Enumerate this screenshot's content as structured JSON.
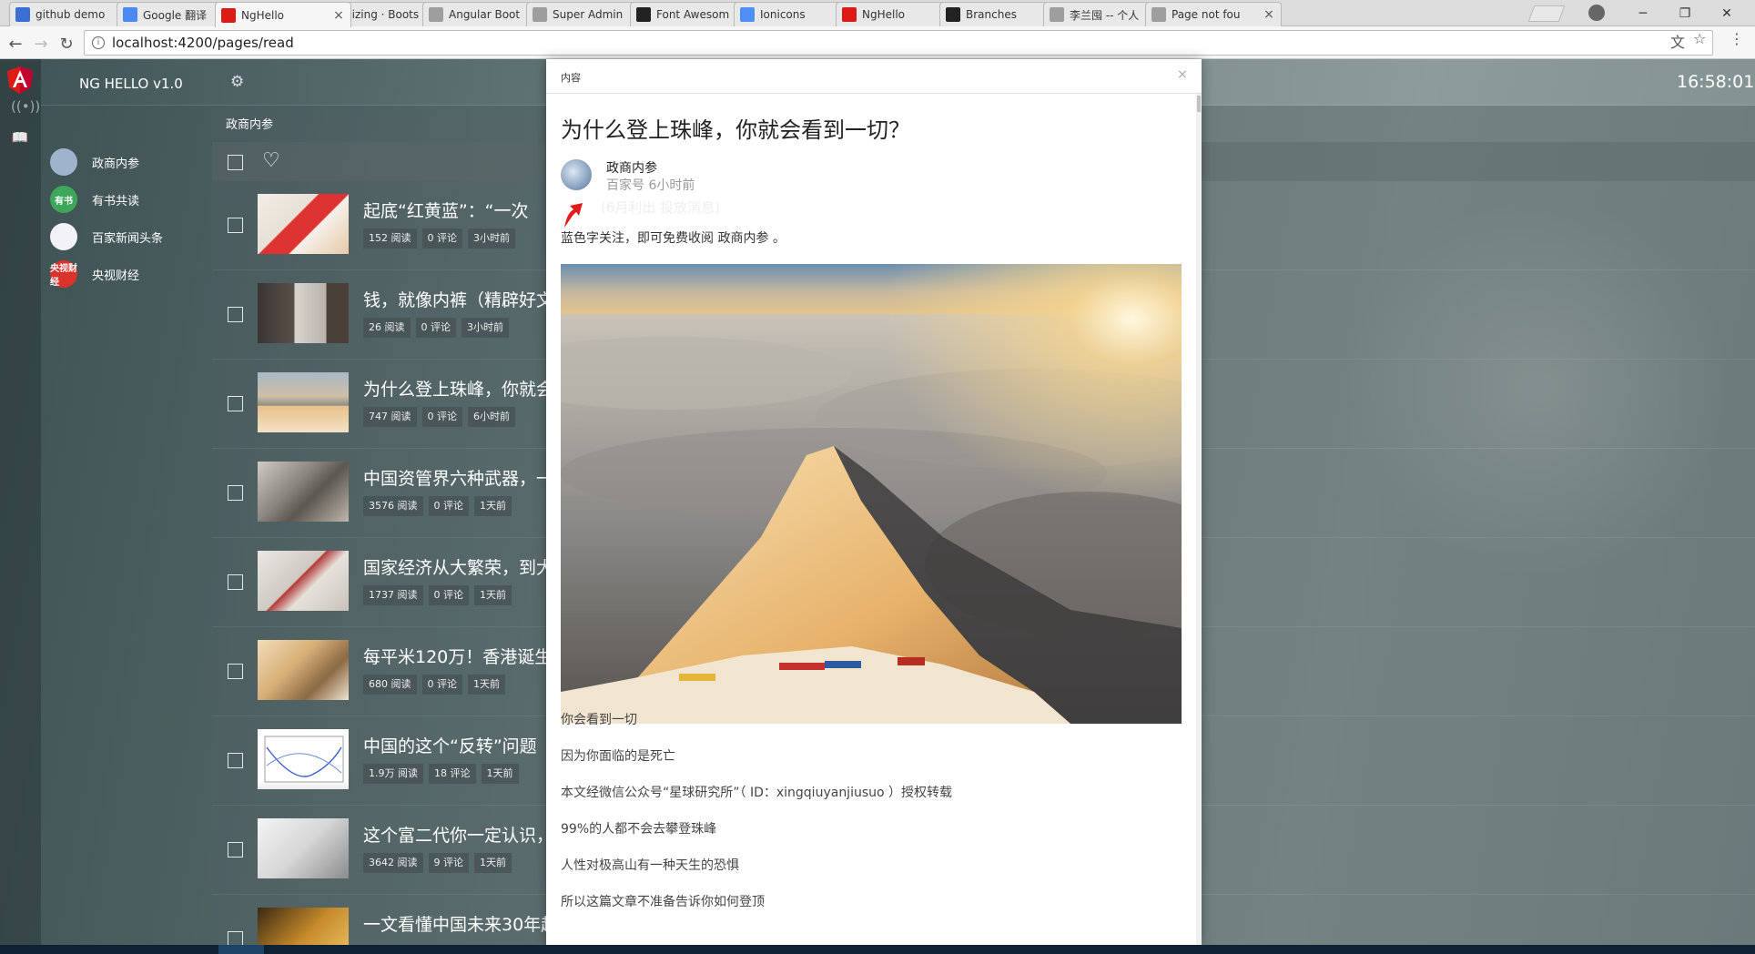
{
  "browser": {
    "tabs": [
      {
        "title": "github demo",
        "icon": "github-translate-icon",
        "color": "#3b6fd6"
      },
      {
        "title": "Google 翻译",
        "icon": "google-translate-icon",
        "color": "#4a8af4"
      },
      {
        "title": "NgHello",
        "icon": "angular-icon",
        "color": "#dd1b16",
        "active": true
      },
      {
        "title": "Sizing · Boots",
        "icon": "bootstrap-icon",
        "color": "#563d7c"
      },
      {
        "title": "Angular Boot",
        "icon": "page-icon",
        "color": "#9e9e9e"
      },
      {
        "title": "Super Admin",
        "icon": "page-icon",
        "color": "#9e9e9e"
      },
      {
        "title": "Font Awesom",
        "icon": "font-awesome-icon",
        "color": "#222222"
      },
      {
        "title": "Ionicons",
        "icon": "ionicons-icon",
        "color": "#4e8ef7"
      },
      {
        "title": "NgHello",
        "icon": "angular-icon",
        "color": "#dd1b16"
      },
      {
        "title": "Branches",
        "icon": "github-icon",
        "color": "#222222"
      },
      {
        "title": "李兰囤 -- 个人",
        "icon": "page-icon",
        "color": "#9e9e9e"
      },
      {
        "title": "Page not fou",
        "icon": "page-icon",
        "color": "#9e9e9e"
      }
    ],
    "url": "localhost:4200/pages/read"
  },
  "app": {
    "brand": "NG HELLO v1.0",
    "clock": "16:58:01",
    "sidebar": [
      {
        "label": "政商内参",
        "avatar_color": "#9fb4cc",
        "avatar_text": ""
      },
      {
        "label": "有书共读",
        "avatar_color": "#3da75b",
        "avatar_text": "有书"
      },
      {
        "label": "百家新闻头条",
        "avatar_color": "#f2f2f7",
        "avatar_text": ""
      },
      {
        "label": "央视财经",
        "avatar_color": "#d9332b",
        "avatar_text": "央视财经"
      }
    ],
    "column_title": "政商内参",
    "articles": [
      {
        "title": "起底“红黄蓝”：“一次",
        "reads": "152 阅读",
        "comments": "0 评论",
        "time": "3小时前",
        "thumb": "red-room"
      },
      {
        "title": "钱，就像内裤（精辟好文",
        "reads": "26 阅读",
        "comments": "0 评论",
        "time": "3小时前",
        "thumb": "window-man"
      },
      {
        "title": "为什么登上珠峰，你就会",
        "reads": "747 阅读",
        "comments": "0 评论",
        "time": "6小时前",
        "thumb": "mountain"
      },
      {
        "title": "中国资管界六种武器，一",
        "reads": "3576 阅读",
        "comments": "0 评论",
        "time": "1天前",
        "thumb": "machine"
      },
      {
        "title": "国家经济从大繁荣，到大",
        "reads": "1737 阅读",
        "comments": "0 评论",
        "time": "1天前",
        "thumb": "graffiti"
      },
      {
        "title": "每平米120万！香港诞生",
        "reads": "680 阅读",
        "comments": "0 评论",
        "time": "1天前",
        "thumb": "interior"
      },
      {
        "title": "中国的这个“反转”问题",
        "reads": "1.9万 阅读",
        "comments": "18 评论",
        "time": "1天前",
        "thumb": "chart"
      },
      {
        "title": "这个富二代你一定认识，",
        "reads": "3642 阅读",
        "comments": "9 评论",
        "time": "1天前",
        "thumb": "portrait"
      },
      {
        "title": "一文看懂中国未来30年超",
        "reads": "",
        "comments": "",
        "time": "",
        "thumb": "gold"
      }
    ]
  },
  "modal": {
    "header": "内容",
    "close": "×",
    "title": "为什么登上珠峰，你就会看到一切？",
    "author": "政商内参",
    "source_time": "百家号   6小时前",
    "ghost_text": "(6月利出     投放消息)",
    "intro": "蓝色字关注，即可免费收阅 政商内参 。",
    "paragraphs": [
      "你会看到一切",
      "因为你面临的是死亡",
      "本文经微信公众号“星球研究所”（ ID：xingqiuyanjiusuo ）授权转载",
      "99%的人都不会去攀登珠峰",
      "人性对极高山有一种天生的恐惧",
      "所以这篇文章不准备告诉你如何登顶"
    ]
  }
}
